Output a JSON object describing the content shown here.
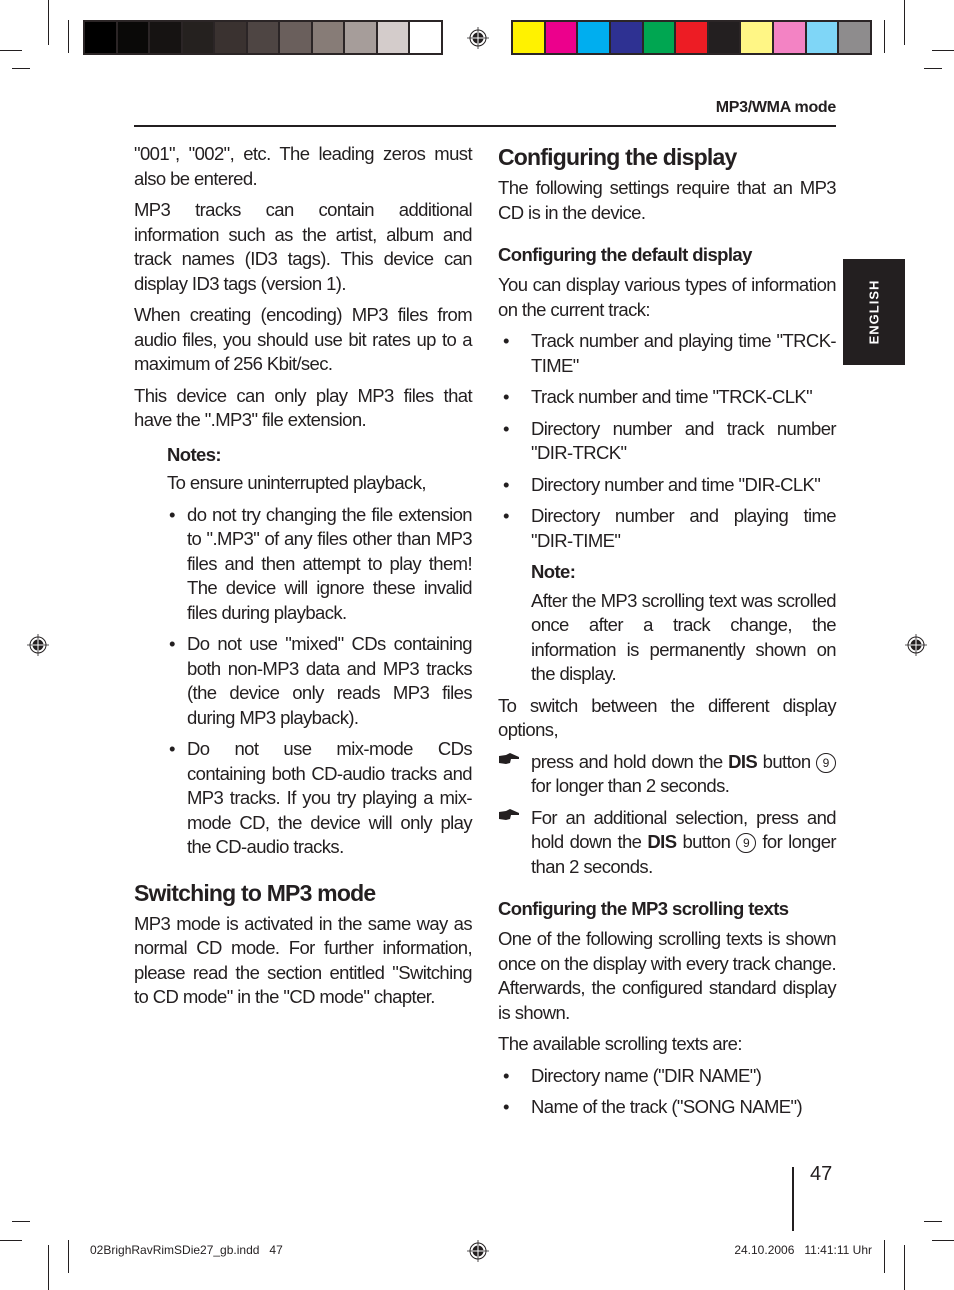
{
  "print_marks": {
    "gray_swatches": [
      "#000000",
      "#0a0908",
      "#161312",
      "#25211f",
      "#3a3230",
      "#4e4543",
      "#6a5f5c",
      "#877c77",
      "#a69d9a",
      "#d4cccb",
      "#ffffff"
    ],
    "color_swatches": [
      "#fff200",
      "#ec008c",
      "#00aeef",
      "#2e3192",
      "#00a651",
      "#ed1c24",
      "#231f20",
      "#fff685",
      "#f383c4",
      "#7fd6f7",
      "#8e8c8d"
    ]
  },
  "header": {
    "running_head": "MP3/WMA mode"
  },
  "language_tab": "ENGLISH",
  "left_column": {
    "paragraphs": [
      "\"001\", \"002\", etc. The leading zeros must also be entered.",
      "MP3 tracks can contain additional information such as the artist, album and track names (ID3 tags). This device can display ID3 tags (version 1).",
      "When creating (encoding) MP3 files from audio files, you should use bit rates up to a maximum of 256 Kbit/sec.",
      "This device can only play MP3 files that have the \".MP3\" file extension."
    ],
    "notes": {
      "title": "Notes:",
      "intro": "To ensure uninterrupted playback,",
      "items": [
        "do not try changing the file extension to \".MP3\" of any files other than MP3 files and then attempt to play them! The device will ignore these invalid files during playback.",
        "Do not use \"mixed\" CDs containing both non-MP3 data and MP3 tracks (the device only reads MP3 files during MP3 playback).",
        "Do not use mix-mode CDs containing both CD-audio tracks and MP3 tracks. If you try playing a mix-mode CD, the device will only play the CD-audio tracks."
      ]
    },
    "section": {
      "heading": "Switching to MP3 mode",
      "body": "MP3 mode is activated in the same way as normal CD mode. For further information, please read the section entitled \"Switching to CD mode\" in the \"CD mode\" chapter."
    }
  },
  "right_column": {
    "heading": "Configuring the display",
    "intro": "The following settings require that an MP3 CD is in the device.",
    "default_display": {
      "heading": "Configuring the default display",
      "intro": "You can display various types of information on the current track:",
      "items": [
        "Track number and playing time \"TRCK-TIME\"",
        "Track number and time \"TRCK-CLK\"",
        "Directory number and track number \"DIR-TRCK\"",
        "Directory number and time \"DIR-CLK\"",
        "Directory number and playing time \"DIR-TIME\""
      ],
      "note_title": "Note:",
      "note_body": "After the MP3 scrolling text was scrolled once after a track change, the information is permanently shown on the display.",
      "switch_intro": "To switch between the different display options,",
      "steps": [
        {
          "pre": "press and hold down the ",
          "key": "DIS",
          "mid": " button ",
          "num": "9",
          "post": " for longer than 2 seconds."
        },
        {
          "pre": "For an additional selection, press and hold down the ",
          "key": "DIS",
          "mid": " button ",
          "num": "9",
          "post": " for longer than 2 seconds."
        }
      ]
    },
    "scrolling": {
      "heading": "Configuring the MP3 scrolling texts",
      "intro": "One of the following scrolling texts is shown once on the display with every track change. Afterwards, the configured standard display is shown.",
      "list_intro": "The available scrolling texts are:",
      "items": [
        "Directory name (\"DIR NAME\")",
        "Name of the track (\"SONG NAME\")"
      ]
    }
  },
  "footer": {
    "page_number": "47",
    "slug_file": "02BrighRavRimSDie27_gb.indd   47",
    "slug_date": "24.10.2006   11:41:11 Uhr"
  }
}
